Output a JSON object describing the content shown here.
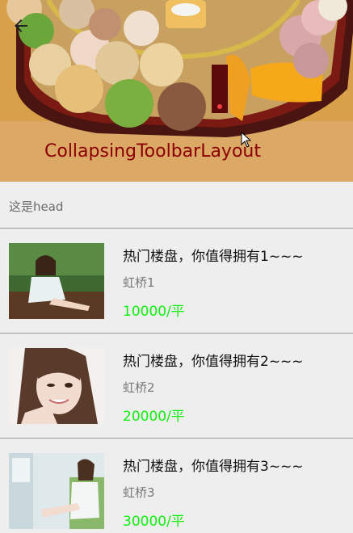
{
  "toolbar": {
    "title": "CollapsingToolbarLayout",
    "back_icon": "arrow-back-icon",
    "header_image": "ice-cream-platter-photo"
  },
  "head": {
    "text": "这是head"
  },
  "list": {
    "items": [
      {
        "title": "热门楼盘，你值得拥有1~~~",
        "location": "虹桥1",
        "price": "10000/平",
        "thumbnail": "girl-sitting-photo"
      },
      {
        "title": "热门楼盘，你值得拥有2~~~",
        "location": "虹桥2",
        "price": "20000/平",
        "thumbnail": "girl-smiling-photo"
      },
      {
        "title": "热门楼盘，你值得拥有3~~~",
        "location": "虹桥3",
        "price": "30000/平",
        "thumbnail": "girl-window-photo"
      }
    ]
  },
  "colors": {
    "title_text": "#8b0000",
    "price_text": "#11ee11",
    "background": "#eeeeee",
    "divider": "#9a9a9a"
  }
}
